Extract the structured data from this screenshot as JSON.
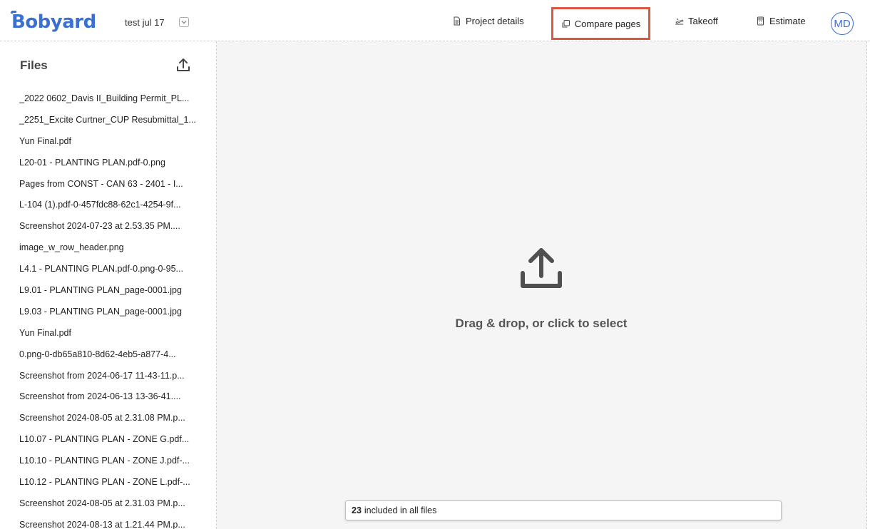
{
  "app": {
    "logo_text": "Bobyard",
    "project_name": "test jul 17"
  },
  "nav": {
    "project_details": "Project details",
    "compare_pages": "Compare pages",
    "takeoff": "Takeoff",
    "estimate": "Estimate"
  },
  "user": {
    "initials": "MD"
  },
  "sidebar": {
    "title": "Files",
    "files": [
      "_2022 0602_Davis II_Building Permit_PL...",
      "_2251_Excite Curtner_CUP Resubmittal_1...",
      "Yun Final.pdf",
      "L20-01 - PLANTING PLAN.pdf-0.png",
      "Pages from CONST - CAN 63 - 2401 - I...",
      "L-104 (1).pdf-0-457fdc88-62c1-4254-9f...",
      "Screenshot 2024-07-23 at 2.53.35 PM....",
      "image_w_row_header.png",
      "L4.1 - PLANTING PLAN.pdf-0.png-0-95...",
      "L9.01 - PLANTING PLAN_page-0001.jpg",
      "L9.03 - PLANTING PLAN_page-0001.jpg",
      "Yun Final.pdf",
      "0.png-0-db65a810-8d62-4eb5-a877-4...",
      "Screenshot from 2024-06-17 11-43-11.p...",
      "Screenshot from 2024-06-13 13-36-41....",
      "Screenshot 2024-08-05 at 2.31.08 PM.p...",
      "L10.07 - PLANTING PLAN - ZONE G.pdf...",
      "L10.10 - PLANTING PLAN - ZONE J.pdf-...",
      "L10.12 - PLANTING PLAN - ZONE L.pdf-...",
      "Screenshot 2024-08-05 at 2.31.03 PM.p...",
      "Screenshot 2024-08-13 at 1.21.44 PM.p..."
    ]
  },
  "dropzone": {
    "text": "Drag & drop, or click to select"
  },
  "status": {
    "count": "23",
    "label": "included in all files"
  },
  "colors": {
    "brand": "#3b6fd1",
    "highlight": "#d9573e"
  },
  "icons": {
    "project_details": "document-icon",
    "compare_pages": "copy-pages-icon",
    "takeoff": "takeoff-icon",
    "estimate": "calculator-icon",
    "upload": "upload-icon",
    "dropdown": "chevron-down-icon"
  }
}
